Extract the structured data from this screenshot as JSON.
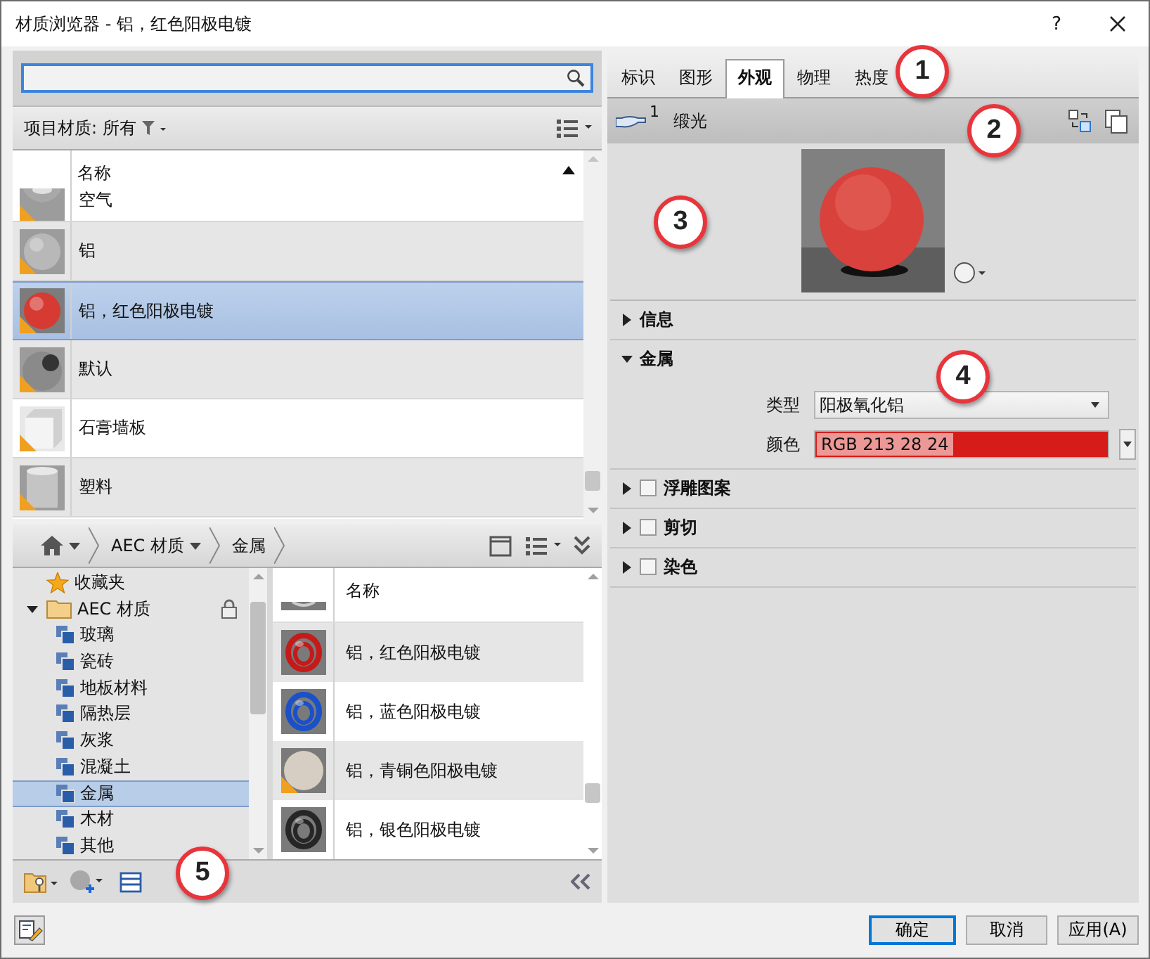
{
  "window": {
    "title": "材质浏览器 - 铝，红色阳极电镀",
    "help": "?"
  },
  "filter": {
    "label": "项目材质: 所有"
  },
  "materials": {
    "header": "名称",
    "rows": [
      {
        "name": "空气",
        "kind": "bowl",
        "color": "#a8a8a8",
        "warning": true,
        "selected": false
      },
      {
        "name": "铝",
        "kind": "sphere",
        "color": "#b8b8b8",
        "warning": true,
        "selected": false
      },
      {
        "name": "铝，红色阳极电镀",
        "kind": "sphere",
        "color": "#d63a32",
        "warning": true,
        "selected": true
      },
      {
        "name": "默认",
        "kind": "sphere-hole",
        "color": "#8a8a8a",
        "warning": true,
        "selected": false
      },
      {
        "name": "石膏墙板",
        "kind": "cube",
        "color": "#d0d0d0",
        "warning": true,
        "selected": false
      },
      {
        "name": "塑料",
        "kind": "cylinder",
        "color": "#c4c4c4",
        "warning": true,
        "selected": false
      }
    ]
  },
  "breadcrumb": [
    {
      "label": "AEC 材质",
      "dropdown": true
    },
    {
      "label": "金属",
      "dropdown": false
    }
  ],
  "library_tree": [
    {
      "label": "收藏夹",
      "kind": "favorites",
      "selected": false
    },
    {
      "label": "AEC 材质",
      "kind": "folder",
      "expanded": true,
      "locked": true,
      "selected": false,
      "children": [
        {
          "label": "玻璃",
          "selected": false
        },
        {
          "label": "瓷砖",
          "selected": false
        },
        {
          "label": "地板材料",
          "selected": false
        },
        {
          "label": "隔热层",
          "selected": false
        },
        {
          "label": "灰浆",
          "selected": false
        },
        {
          "label": "混凝土",
          "selected": false
        },
        {
          "label": "金属",
          "selected": true
        },
        {
          "label": "木材",
          "selected": false
        },
        {
          "label": "其他",
          "selected": false
        }
      ]
    }
  ],
  "library_list": {
    "header": "名称",
    "rows": [
      {
        "name": "铝，红色阳极电镀",
        "kind": "ring",
        "color": "#c41a1a",
        "warning": false
      },
      {
        "name": "铝，蓝色阳极电镀",
        "kind": "ring",
        "color": "#1a50c8",
        "warning": false
      },
      {
        "name": "铝，青铜色阳极电镀",
        "kind": "sphere",
        "color": "#d6cec2",
        "warning": true
      },
      {
        "name": "铝，银色阳极电镀",
        "kind": "ring",
        "color": "#262626",
        "warning": false
      }
    ]
  },
  "tabs": [
    {
      "label": "标识",
      "selected": false
    },
    {
      "label": "图形",
      "selected": false
    },
    {
      "label": "外观",
      "selected": true
    },
    {
      "label": "物理",
      "selected": false
    },
    {
      "label": "热度",
      "selected": false
    }
  ],
  "asset": {
    "count": "1",
    "name": "缎光"
  },
  "sections": [
    {
      "label": "信息",
      "expanded": false
    },
    {
      "label": "金属",
      "expanded": true,
      "fields": [
        {
          "label": "类型",
          "kind": "select",
          "value": "阳极氧化铝"
        },
        {
          "label": "颜色",
          "kind": "color",
          "value": "RGB 213 28 24",
          "color": "#d51c18"
        }
      ]
    },
    {
      "label": "浮雕图案",
      "expanded": false,
      "checked": false
    },
    {
      "label": "剪切",
      "expanded": false,
      "checked": false
    },
    {
      "label": "染色",
      "expanded": false,
      "checked": false
    }
  ],
  "buttons": [
    {
      "label": "确定",
      "default": true
    },
    {
      "label": "取消",
      "default": false
    },
    {
      "label": "应用(A)",
      "default": false
    }
  ],
  "callouts": [
    "1",
    "2",
    "3",
    "4",
    "5"
  ]
}
